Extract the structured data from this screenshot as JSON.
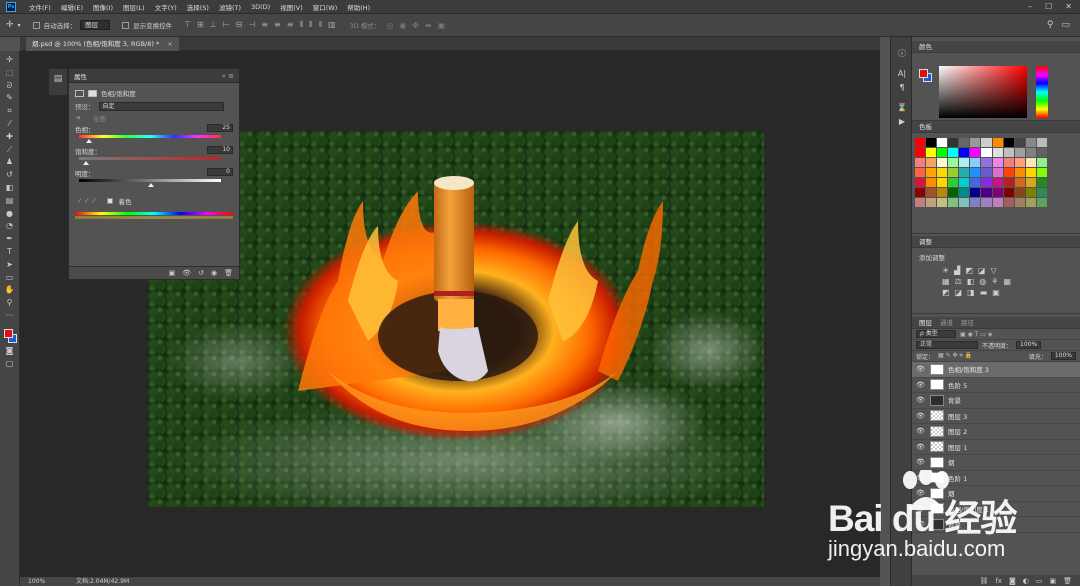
{
  "menubar": {
    "items": [
      "文件(F)",
      "编辑(E)",
      "图像(I)",
      "图层(L)",
      "文字(Y)",
      "选择(S)",
      "滤镜(T)",
      "3D(D)",
      "视图(V)",
      "窗口(W)",
      "帮助(H)"
    ],
    "app_icon": "Ps"
  },
  "optionsbar": {
    "auto_select_label": "自动选择：",
    "auto_select_value": "图层",
    "show_transform_label": "显示变换控件",
    "mode_3d_label": "3D 模式："
  },
  "document": {
    "tab_title": "烟.psd @ 100% (色相/饱和度 3, RGB/8) *"
  },
  "statusbar": {
    "zoom": "100%",
    "doc_info": "文档:2.04M/42.9M"
  },
  "properties": {
    "tab": "属性",
    "adjustment_name": "色相/饱和度",
    "preset_label": "预设：",
    "preset_value": "自定",
    "channel_value": "全图",
    "hue_label": "色相：",
    "hue_value": "25",
    "saturation_label": "饱和度：",
    "saturation_value": "10",
    "lightness_label": "明度：",
    "lightness_value": "0",
    "colorize_label": "着色",
    "hue_level": 0.07,
    "saturation_level": 0.05,
    "lightness_level": 0.5
  },
  "color_panel": {
    "title": "颜色",
    "foreground": "#e01010",
    "background": "#1a5fd0"
  },
  "swatches_panel": {
    "title": "色板"
  },
  "adjustments_panel": {
    "title": "调整",
    "add_label": "添加调整"
  },
  "layers_panel": {
    "tabs": [
      "图层",
      "通道",
      "路径"
    ],
    "kind_label": "ρ 类型",
    "blend_mode": "正常",
    "opacity_label": "不透明度：",
    "opacity_value": "100%",
    "lock_label": "锁定：",
    "fill_label": "填充：",
    "fill_value": "100%",
    "layers": [
      {
        "name": "色相/饱和度 3",
        "selected": true
      },
      {
        "name": "色阶 5",
        "selected": false
      },
      {
        "name": "背景",
        "selected": false
      },
      {
        "name": "图层 3",
        "selected": false
      },
      {
        "name": "图层 2",
        "selected": false
      },
      {
        "name": "图层 1",
        "selected": false
      },
      {
        "name": "烟",
        "selected": false
      },
      {
        "name": "色阶 1",
        "selected": false
      },
      {
        "name": "烟",
        "selected": false
      },
      {
        "name": "色相/饱和度 1",
        "selected": false
      },
      {
        "name": "背景",
        "selected": false
      }
    ]
  },
  "watermark": {
    "logo_text": "Bai du 经验",
    "url": "jingyan.baidu.com"
  }
}
